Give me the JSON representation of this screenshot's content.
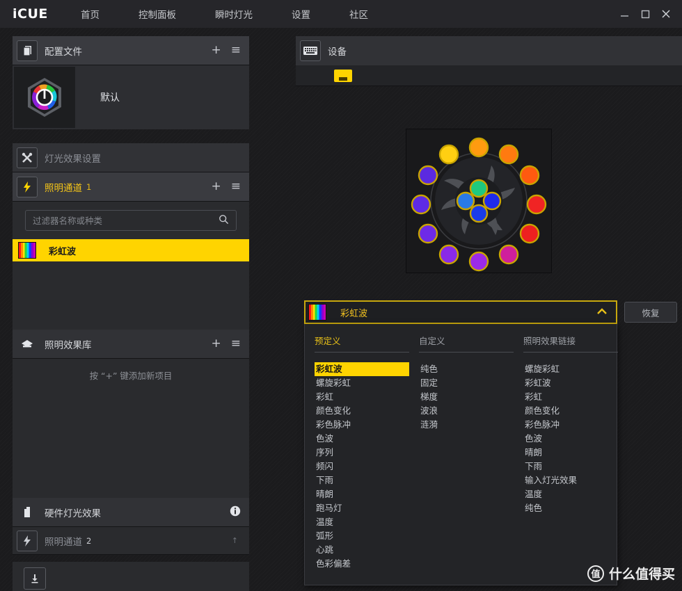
{
  "app": {
    "logo": "iCUE",
    "nav": [
      {
        "label": "首页",
        "name": "nav-home"
      },
      {
        "label": "控制面板",
        "name": "nav-dashboard"
      },
      {
        "label": "瞬时灯光",
        "name": "nav-instant-lighting"
      },
      {
        "label": "设置",
        "name": "nav-settings"
      },
      {
        "label": "社区",
        "name": "nav-community"
      }
    ],
    "window": {
      "minimize": "—",
      "maximize": "▢",
      "close": "✕"
    }
  },
  "sidebar": {
    "profiles": {
      "title": "配置文件",
      "add": "+",
      "menu": "≡",
      "items": [
        {
          "name": "默认"
        }
      ]
    },
    "lighting_settings": {
      "title": "灯光效果设置"
    },
    "lighting_channel_1": {
      "title": "照明通道",
      "number": "1",
      "add": "+",
      "menu": "≡"
    },
    "filter": {
      "placeholder": "过滤器名称或种类",
      "value": "",
      "icon": "search-icon"
    },
    "effects": [
      {
        "label": "彩虹波",
        "selected": true
      }
    ],
    "effect_library": {
      "title": "照明效果库",
      "add": "+",
      "menu": "≡",
      "hint": "按 “+” 键添加新项目"
    },
    "hardware_lighting": {
      "title": "硬件灯光效果",
      "info": "i"
    },
    "lighting_channel_2": {
      "title": "照明通道",
      "number": "2",
      "caret": "↑"
    },
    "download": {
      "icon": "download-icon"
    }
  },
  "device": {
    "title": "设备",
    "icon": "keyboard-icon",
    "tab_icon": "device-tab-icon",
    "fan": {
      "outer_leds": [
        "#ff9b10",
        "#ffcf12",
        "#ff7a10",
        "#5b2ae0",
        "#ff5a10",
        "#5e2ae6",
        "#f02424",
        "#6e2ae8",
        "#ee2020",
        "#8a2ae8",
        "#cf1f9c",
        "#9b2ae8",
        "#b72ae8"
      ],
      "inner_leds": [
        "#1fc97f",
        "#2a7ae8",
        "#1f2aea",
        "#1a3ce8"
      ]
    }
  },
  "dropdown": {
    "header": {
      "title": "彩虹波",
      "caret": "⌃"
    },
    "columns": [
      {
        "title": "预定义",
        "active": true,
        "options": [
          "彩虹波",
          "螺旋彩虹",
          "彩虹",
          "颜色变化",
          "彩色脉冲",
          "色波",
          "序列",
          "频闪",
          "下雨",
          "晴朗",
          "跑马灯",
          "温度",
          "弧形",
          "心跳",
          "色彩偏差"
        ],
        "selected": "彩虹波"
      },
      {
        "title": "自定义",
        "active": false,
        "options": [
          "纯色",
          "固定",
          "梯度",
          "波浪",
          "涟漪"
        ],
        "selected": null
      },
      {
        "title": "照明效果链接",
        "active": false,
        "options": [
          "螺旋彩虹",
          "彩虹波",
          "彩虹",
          "颜色变化",
          "彩色脉冲",
          "色波",
          "晴朗",
          "下雨",
          "输入灯光效果",
          "温度",
          "纯色"
        ],
        "selected": null
      }
    ]
  },
  "restore_button": {
    "label": "恢复"
  },
  "watermark": {
    "badge": "值",
    "text": "什么值得买"
  },
  "colors": {
    "accent_yellow": "#ffd400",
    "panel_bg": "#2a2b2e",
    "header_bg": "#3a3b40",
    "titlebar_bg": "#26262a",
    "text": "#d6d8dc"
  }
}
